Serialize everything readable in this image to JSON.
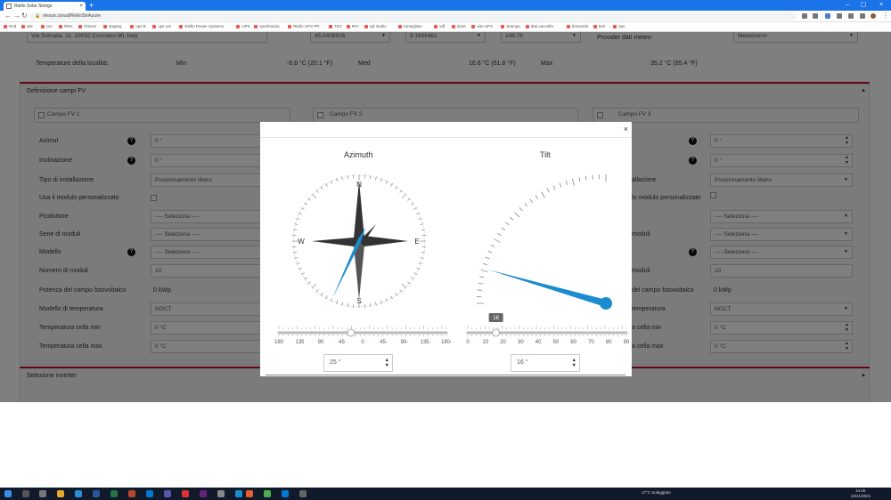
{
  "browser": {
    "tab_title": "Riello Solar Strings",
    "url": "riesun.cloud/RelloStrAzure",
    "new_tab": "+",
    "bookmarks": [
      "Red",
      "site",
      "pro",
      "RiRL",
      "Riesun",
      "staging",
      "ups B",
      "ups vre",
      "Riello Power Systems",
      "UPS",
      "sportmania",
      "Riello UPS PR",
      "TEC",
      "RIG",
      "sql studio",
      "consigliato",
      "vdf",
      "dose",
      "sito-UPS",
      "Stampa",
      "dati.cancella",
      "domande",
      "test",
      "sps"
    ]
  },
  "page": {
    "address_value": "Via Somalia, 11, 20032 Cormano MI, Italy",
    "lat_value": "45.5408926",
    "lon_value": "9.1606461",
    "alt_value": "148.76",
    "provider_label": "Provider dati meteo:",
    "provider_value": "Meteonorm",
    "temp_label": "Temperature della località:",
    "min_label": "Min",
    "min_value": "-6.6 °C (20.1 °F)",
    "med_label": "Med",
    "med_value": "16.6 °C (61.8 °F)",
    "max_label": "Max",
    "max_value": "35.2 °C (95.4 °F)",
    "fv_section_title": "Definizione campi FV",
    "fv1_title": "Campo FV 1",
    "fv2_title": "Campo FV 2",
    "fv3_title": "Campo FV 3",
    "labels": {
      "azimut": "Azimut",
      "inclinazione": "Inclinazione",
      "tipo": "Tipo di installazione",
      "usa_modulo": "Usa il modulo personalizzato",
      "produttore": "Produttore",
      "serie": "Serie di moduli",
      "modello": "Modello",
      "numero": "Numero di moduli",
      "potenza": "Potenza del campo fotovoltaico",
      "modello_temp": "Modello di temperatura",
      "temp_min": "Temperatura cella min",
      "temp_max": "Temperatura cella max"
    },
    "fv3_labels": {
      "tipo": "allazione",
      "usa_modulo": "lo modulo personalizzato",
      "serie": "moduli",
      "numero": "moduli",
      "potenza": "del campo fotovoltaico",
      "modello_temp": "temperatura",
      "temp_min": "a cella min",
      "temp_max": "a cella max"
    },
    "values": {
      "azimut": "0 °",
      "inclinazione": "0 °",
      "tipo": "Posizionamento libero",
      "produttore": "---- Seleziona ----",
      "serie": "---- Seleziona ----",
      "modello": "---- Seleziona ----",
      "numero": "10",
      "potenza": "0 kWp",
      "modello_temp": "NOCT",
      "temp_min": "0 °C",
      "temp_max": "0 °C"
    },
    "inverter_section_title": "Selezione inverter"
  },
  "modal": {
    "close": "×",
    "azimuth_title": "Azimuth",
    "tilt_title": "Tilt",
    "compass_labels": {
      "n": "N",
      "e": "E",
      "s": "S",
      "w": "W"
    },
    "azimuth_value": 25,
    "azimuth_field": "25 °",
    "azimuth_ticks": [
      "180",
      "135",
      "90",
      "45",
      "0",
      "45-",
      "90-",
      "135-",
      "180-"
    ],
    "azimuth_range": [
      -180,
      180
    ],
    "tilt_value": 16,
    "tilt_field": "16 °",
    "tilt_tooltip": "16",
    "tilt_ticks": [
      "0",
      "10",
      "20",
      "30",
      "40",
      "50",
      "60",
      "70",
      "80",
      "90"
    ],
    "tilt_range": [
      0,
      90
    ],
    "accent": "#1a8ccf",
    "dark": "#333333"
  },
  "taskbar": {
    "weather_text": "17°C  Soleggiato",
    "time": "14:45",
    "date": "22/11/2021"
  }
}
